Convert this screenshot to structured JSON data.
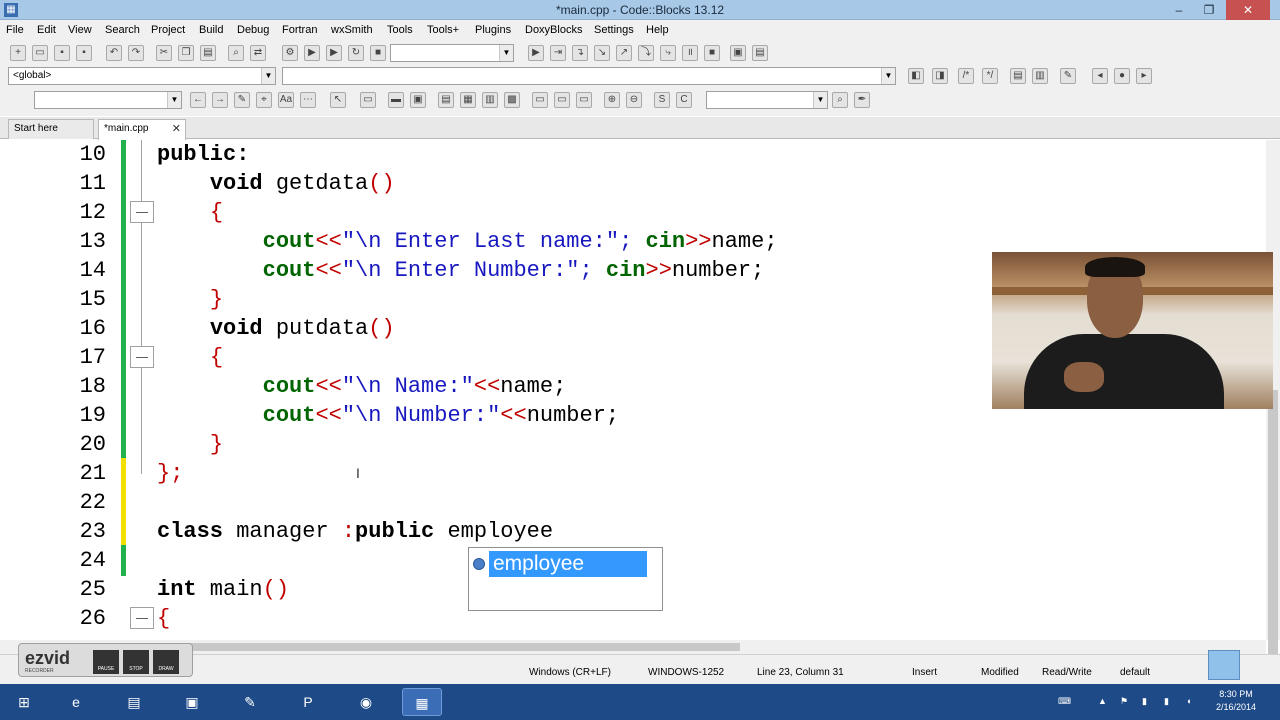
{
  "window": {
    "title": "*main.cpp - Code::Blocks 13.12",
    "minimize": "–",
    "maximize": "❐",
    "close": "✕"
  },
  "menu": [
    "File",
    "Edit",
    "View",
    "Search",
    "Project",
    "Build",
    "Debug",
    "Fortran",
    "wxSmith",
    "Tools",
    "Tools+",
    "Plugins",
    "DoxyBlocks",
    "Settings",
    "Help"
  ],
  "toolbar": {
    "scope_value": "<global>",
    "search_value": "",
    "search2_value": ""
  },
  "tabs": [
    {
      "label": "Start here",
      "active": false
    },
    {
      "label": "*main.cpp",
      "active": true,
      "close": "✕"
    }
  ],
  "editor": {
    "line_numbers": [
      "10",
      "11",
      "12",
      "13",
      "14",
      "15",
      "16",
      "17",
      "18",
      "19",
      "20",
      "21",
      "22",
      "23",
      "24",
      "25",
      "26"
    ],
    "lines": {
      "l10_kw": "public:",
      "l11_kw": "void",
      "l11_rest": " getdata",
      "l11_paren": "()",
      "l12_brace": "{",
      "l13_obj": "cout",
      "l13_op": "<<",
      "l13_str": "\"\\n Enter Last name:\";",
      "l13_obj2": " cin",
      "l13_op2": ">>",
      "l13_rest": "name;",
      "l14_obj": "cout",
      "l14_op": "<<",
      "l14_str": "\"\\n Enter Number:\";",
      "l14_obj2": " cin",
      "l14_op2": ">>",
      "l14_rest": "number;",
      "l15_brace": "}",
      "l16_kw": "void",
      "l16_rest": " putdata",
      "l16_paren": "()",
      "l17_brace": "{",
      "l18_obj": "cout",
      "l18_op": "<<",
      "l18_str": "\"\\n Name:\"",
      "l18_op2": "<<",
      "l18_rest": "name;",
      "l19_obj": "cout",
      "l19_op": "<<",
      "l19_str": "\"\\n Number:\"",
      "l19_op2": "<<",
      "l19_rest": "number;",
      "l20_brace": "}",
      "l21_brace": "};",
      "l23_kw": "class",
      "l23_mid": " manager ",
      "l23_colon": ":",
      "l23_kw2": "public",
      "l23_rest": " employee",
      "l25_kw": "int",
      "l25_rest": " main",
      "l25_paren": "()",
      "l26_brace": "{"
    },
    "autocomplete": {
      "selected": "employee"
    }
  },
  "statusbar": {
    "line_endings": "Windows (CR+LF)",
    "encoding": "WINDOWS-1252",
    "position": "Line 23, Column 31",
    "mode": "Insert",
    "modified": "Modified",
    "access": "Read/Write",
    "lang": "default"
  },
  "recorder": {
    "logo": "ezvid",
    "sub": "RECORDER",
    "pause": "PAUSE",
    "stop": "STOP",
    "draw": "DRAW"
  },
  "clock": {
    "time": "8:30 PM",
    "date": "2/16/2014"
  },
  "colors": {
    "keyword": "#000060",
    "string": "#1818c0",
    "stream": "#006400",
    "operator": "#c00000",
    "selection": "#3399ff",
    "taskbar": "#1e4a87"
  }
}
